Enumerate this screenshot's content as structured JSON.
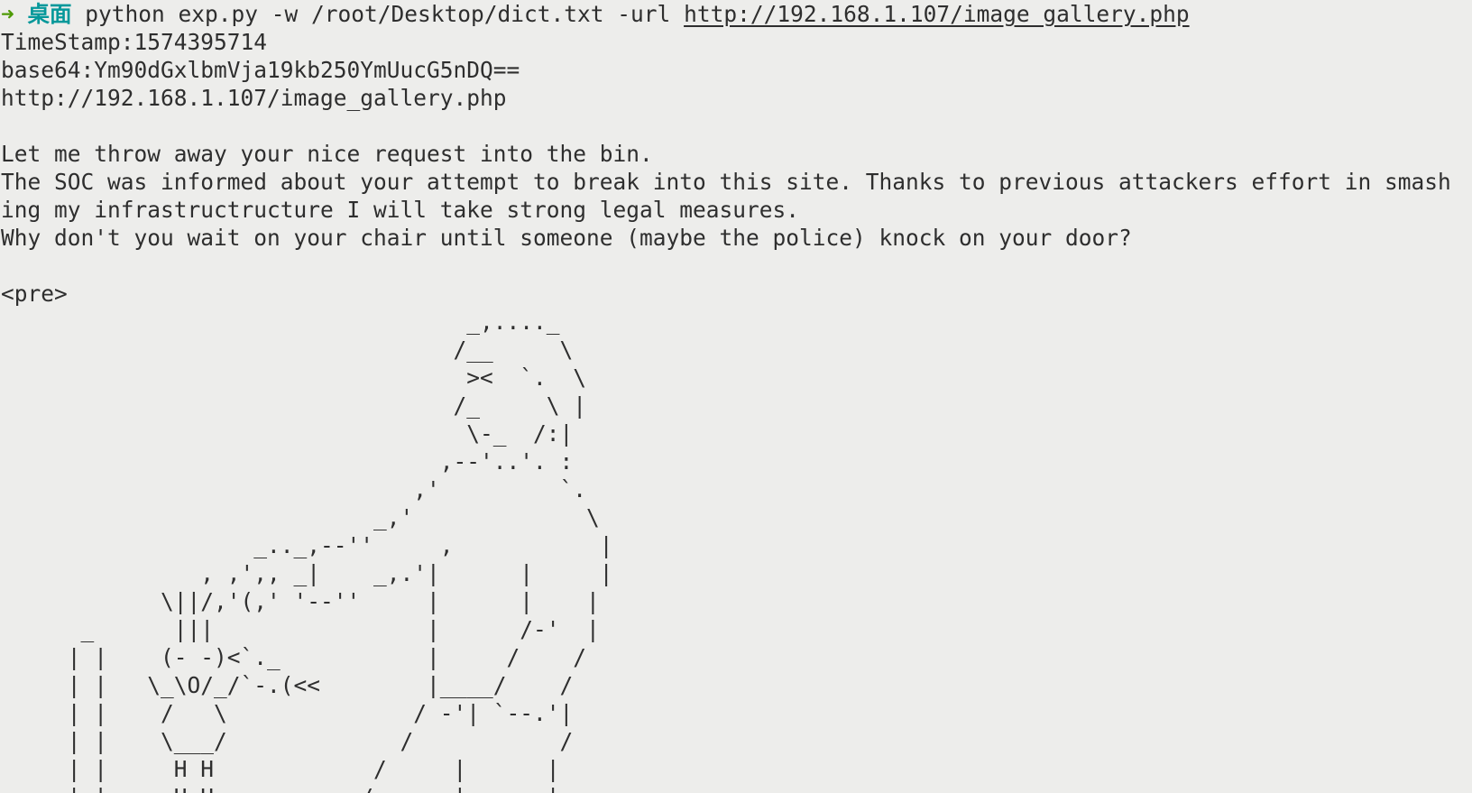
{
  "prompt": {
    "arrow": "➜",
    "dir": "桌面",
    "command": "python exp.py -w /root/Desktop/dict.txt -url ",
    "url": "http://192.168.1.107/image_gallery.php"
  },
  "output": {
    "timestamp": "TimeStamp:1574395714",
    "base64": "base64:Ym90dGxlbmVja19kb250YmUucG5nDQ==",
    "target_url": "http://192.168.1.107/image_gallery.php",
    "blank1": "",
    "msg1": "Let me throw away your nice request into the bin.",
    "msg2": "The SOC was informed about your attempt to break into this site. Thanks to previous attackers effort in smash",
    "msg3": "ing my infrastructructure I will take strong legal measures.",
    "msg4": "Why don't you wait on your chair until someone (maybe the police) knock on your door?",
    "blank2": "",
    "pre_tag": "<pre>"
  },
  "ascii_art": "                                   _,...._\n                                  /__     \\\n                                   ><  `.  \\\n                                  /_     \\ |\n                                   \\-_  /:|\n                                 ,--'..'. :\n                               ,'         `.\n                            _,'             \\\n                   _.._,--''     ,           |\n               , ,',, _|    _,.'|      |     |\n            \\||/,'(,' '--''     |      |    |\n      _      |||                |      /-'  |\n     | |    (- -)<`._           |     /    /\n     | |   \\_\\O/_/`-.(<<        |____/    /\n     | |    /   \\              / -'| `--.'|\n     | |    \\___/             /           /\n     | |     H H            /     |      |\n     | |     H H           /      |      |"
}
